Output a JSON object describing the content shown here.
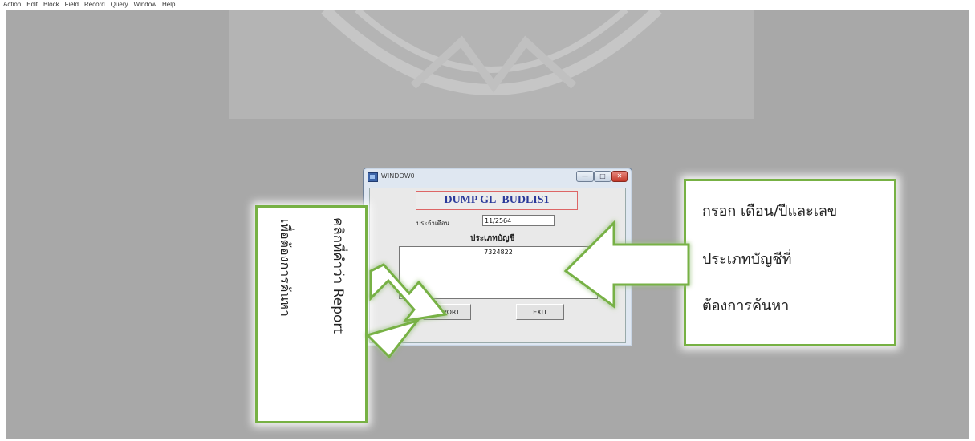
{
  "menubar": {
    "items": [
      "Action",
      "Edit",
      "Block",
      "Field",
      "Record",
      "Query",
      "Window",
      "Help"
    ]
  },
  "window": {
    "title": "WINDOW0",
    "controls": {
      "minimize": "—",
      "maximize": "□",
      "close": "✕"
    },
    "form_title": "DUMP  GL_BUDLIS1",
    "month_label": "ประจำเดือน",
    "month_value": "11/2564",
    "account_label": "ประเภทบัญชี",
    "account_value": "7324822",
    "report_button": "REPORT",
    "exit_button": "EXIT"
  },
  "callouts": {
    "right_lines": [
      "กรอก เดือน/ปีและเลข",
      "ประเภทบัญชีที่",
      "ต้องการค้นหา"
    ],
    "left_line1": "คลิกที่คำว่า Report",
    "left_line2": "เพื่อต้องการค้นหา"
  },
  "colors": {
    "background": "#a8a8a8",
    "callout_border": "#77b144",
    "form_title": "#2b3a9a"
  }
}
